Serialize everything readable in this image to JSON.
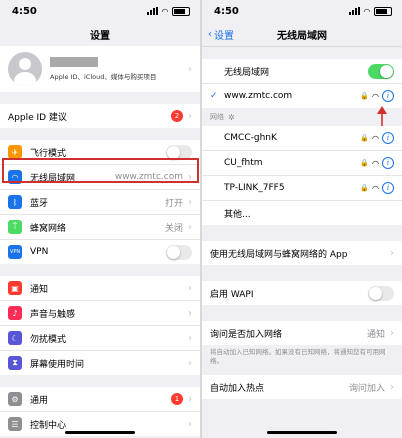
{
  "left": {
    "status_time": "4:50",
    "title": "设置",
    "profile": {
      "subtitle": "Apple ID、iCloud、媒体与购买项目"
    },
    "appleid_suggest": {
      "label": "Apple ID 建议",
      "badge": "2"
    },
    "items1": [
      {
        "label": "飞行模式",
        "icon": "airplane-icon",
        "color": "#ff9500"
      },
      {
        "label": "无线局域网",
        "value": "www.zmtc.com",
        "icon": "wifi-icon",
        "color": "#1a73e8"
      },
      {
        "label": "蓝牙",
        "value": "打开",
        "icon": "bluetooth-icon",
        "color": "#1a73e8"
      },
      {
        "label": "蜂窝网络",
        "value": "关闭",
        "icon": "antenna-icon",
        "color": "#4cd964"
      },
      {
        "label": "VPN",
        "icon": "vpn-icon",
        "color": "#1a73e8"
      }
    ],
    "items2": [
      {
        "label": "通知",
        "icon": "notification-icon",
        "color": "#ff3b30"
      },
      {
        "label": "声音与触感",
        "icon": "sound-icon",
        "color": "#ff2d55"
      },
      {
        "label": "勿扰模式",
        "icon": "moon-icon",
        "color": "#5856d6"
      },
      {
        "label": "屏幕使用时间",
        "icon": "hourglass-icon",
        "color": "#5856d6"
      }
    ],
    "items3": [
      {
        "label": "通用",
        "badge": "1",
        "icon": "gear-icon",
        "color": "#8e8e93"
      },
      {
        "label": "控制中心",
        "icon": "control-center-icon",
        "color": "#8e8e93"
      }
    ]
  },
  "right": {
    "status_time": "4:50",
    "back_label": "设置",
    "title": "无线局域网",
    "wlan_label": "无线局域网",
    "connected": "www.zmtc.com",
    "networks_header": "网络",
    "networks": [
      "CMCC-ghnK",
      "CU_fhtm",
      "TP-LINK_7FF5"
    ],
    "other": "其他...",
    "use_wlan_cellular": "使用无线局域网与蜂窝网络的 App",
    "wapi": "启用 WAPI",
    "ask_join": "询问是否加入网络",
    "ask_join_value": "通知",
    "ask_note": "将自动加入已知网络。如果没有已知网络，将通知您有可用网络。",
    "auto_hotspot": "自动加入热点",
    "auto_hotspot_value": "询问加入"
  },
  "colors": {
    "accent": "#1a73e8",
    "toggle_on": "#4cd964",
    "highlight": "#d0312d"
  }
}
